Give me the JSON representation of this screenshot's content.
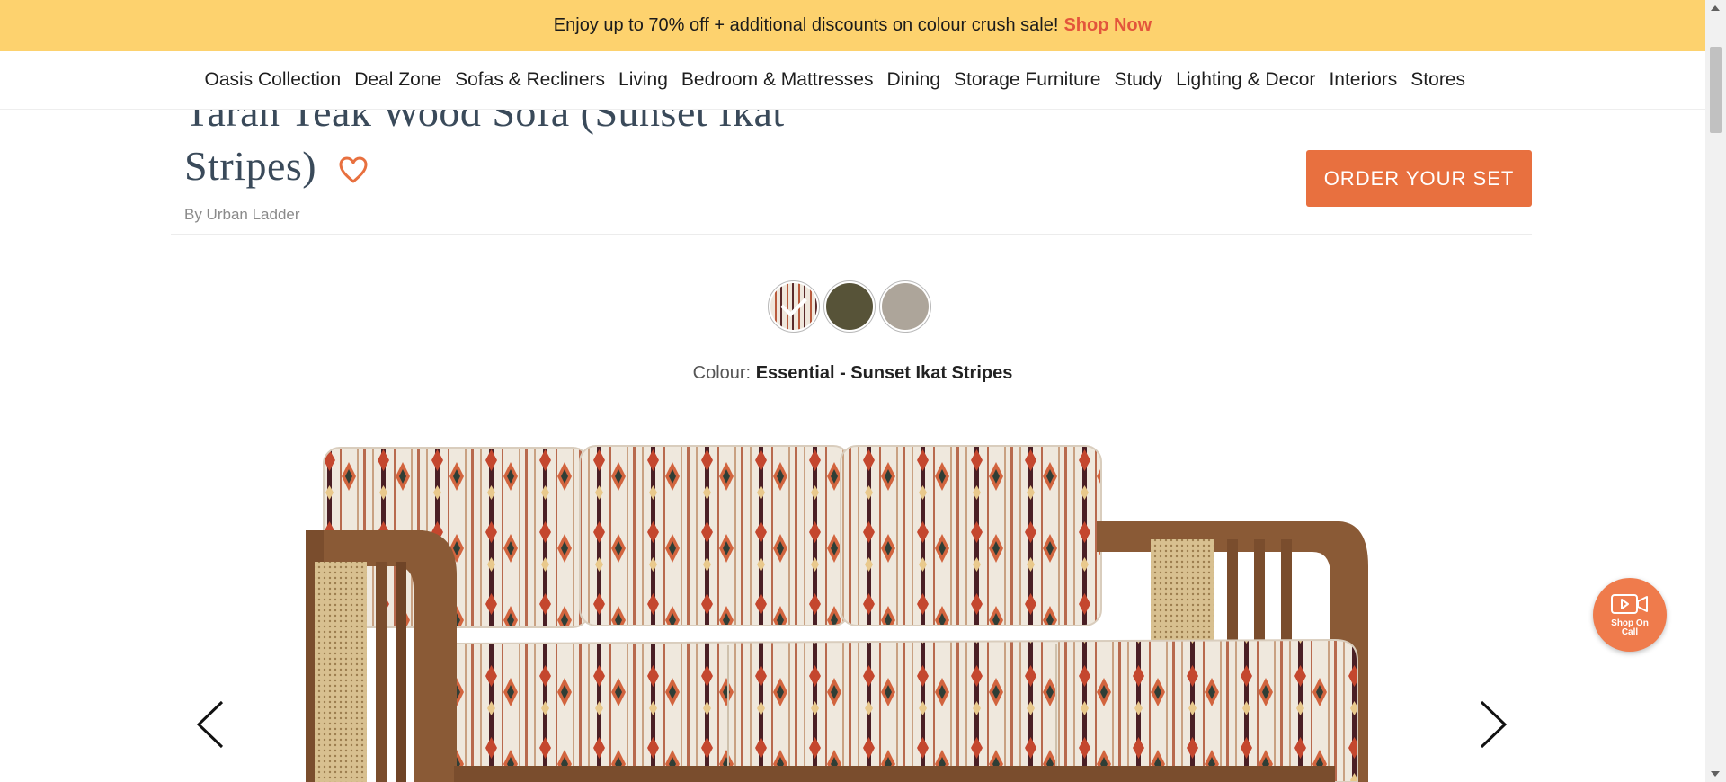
{
  "promo": {
    "text": "Enjoy up to 70% off + additional discounts on colour crush sale!",
    "link": "Shop Now"
  },
  "nav": {
    "items": [
      "Oasis Collection",
      "Deal Zone",
      "Sofas & Recliners",
      "Living",
      "Bedroom & Mattresses",
      "Dining",
      "Storage Furniture",
      "Study",
      "Lighting & Decor",
      "Interiors",
      "Stores"
    ]
  },
  "product": {
    "title": "Taran Teak Wood Sofa (Sunset Ikat Stripes)",
    "brand": "By Urban Ladder",
    "order_label": "ORDER YOUR SET",
    "colour_label": "Colour:",
    "colour_value": "Essential - Sunset Ikat Stripes",
    "swatches": [
      {
        "name": "sunset-ikat-stripes",
        "selected": true
      },
      {
        "name": "olive",
        "color": "#575338",
        "selected": false
      },
      {
        "name": "grey",
        "color": "#ada59a",
        "selected": false
      }
    ]
  },
  "shop_on_call": {
    "label": "Shop On Call"
  },
  "colors": {
    "banner": "#fdd26e",
    "accent": "#e8703f",
    "shop_now": "#e3553b",
    "title": "#3a4a5a"
  },
  "icons": [
    "heart-icon",
    "check-icon",
    "chevron-left-icon",
    "chevron-right-icon",
    "video-call-icon"
  ]
}
